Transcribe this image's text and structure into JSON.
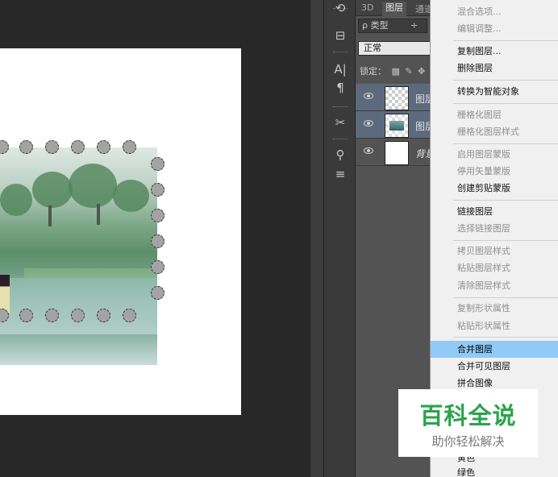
{
  "panel": {
    "tabs": [
      "3D",
      "图层",
      "通道"
    ],
    "filter_label": "ρ 类型",
    "filter_arrow": "÷",
    "blend_mode": "正常",
    "lock_label": "锁定：",
    "layers": [
      {
        "name": "图层",
        "selected": true,
        "thumb": "checker"
      },
      {
        "name": "图层",
        "selected": true,
        "thumb": "photo"
      },
      {
        "name": "背景",
        "selected": false,
        "thumb": "white"
      }
    ]
  },
  "toolstrip": {
    "icons": [
      "history-icon",
      "properties-icon",
      "character-icon",
      "paragraph-icon",
      "tools-icon",
      "brush-presets-icon",
      "adjust-icon"
    ],
    "glyphs": [
      "⟲",
      "⊟",
      "A|",
      "¶",
      "✂",
      "⚲",
      "≡"
    ]
  },
  "context_menu": {
    "items": [
      {
        "label": "混合选项...",
        "enabled": false
      },
      {
        "label": "编辑调整...",
        "enabled": false
      },
      {
        "label": "复制图层...",
        "enabled": true
      },
      {
        "label": "删除图层",
        "enabled": true
      },
      {
        "label": "转换为智能对象",
        "enabled": true
      },
      {
        "label": "栅格化图层",
        "enabled": false
      },
      {
        "label": "栅格化图层样式",
        "enabled": false
      },
      {
        "label": "启用图层蒙版",
        "enabled": false
      },
      {
        "label": "停用矢量蒙版",
        "enabled": false
      },
      {
        "label": "创建剪贴蒙版",
        "enabled": true
      },
      {
        "label": "链接图层",
        "enabled": true
      },
      {
        "label": "选择链接图层",
        "enabled": false
      },
      {
        "label": "拷贝图层样式",
        "enabled": false
      },
      {
        "label": "粘贴图层样式",
        "enabled": false
      },
      {
        "label": "清除图层样式",
        "enabled": false
      },
      {
        "label": "复制形状属性",
        "enabled": false
      },
      {
        "label": "粘贴形状属性",
        "enabled": false
      },
      {
        "label": "合并图层",
        "enabled": true,
        "highlighted": true
      },
      {
        "label": "合并可见图层",
        "enabled": true
      },
      {
        "label": "拼合图像",
        "enabled": true
      },
      {
        "label": "黄色",
        "enabled": true
      },
      {
        "label": "绿色",
        "enabled": true
      }
    ]
  },
  "watermark": {
    "title": "百科全说",
    "subtitle": "助你轻松解决"
  },
  "colors": {
    "menu_highlight": "#91c9f7",
    "watermark_green": "#2ba34b",
    "panel_bg": "#535353",
    "workspace_bg": "#282828"
  }
}
